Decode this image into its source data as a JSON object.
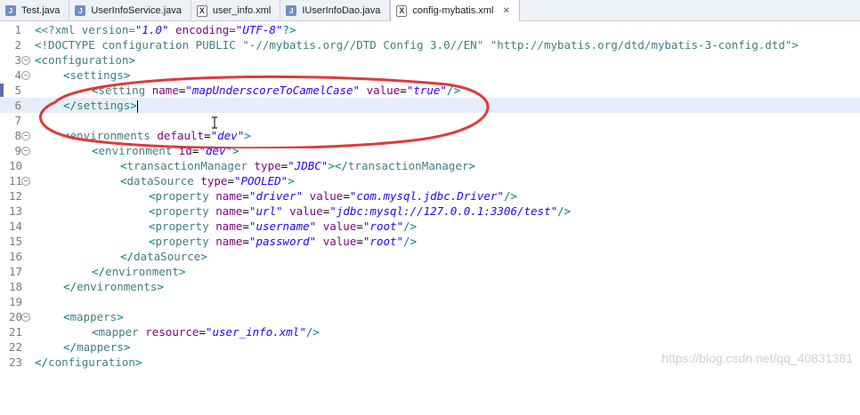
{
  "tabs": [
    {
      "label": "Test.java",
      "icon": "java-file-icon",
      "active": false
    },
    {
      "label": "UserInfoService.java",
      "icon": "java-file-icon",
      "active": false
    },
    {
      "label": "user_info.xml",
      "icon": "xml-file-icon",
      "active": false
    },
    {
      "label": "IUserInfoDao.java",
      "icon": "java-file-icon",
      "active": false
    },
    {
      "label": "config-mybatis.xml",
      "icon": "xml-file-icon",
      "active": true,
      "close": "✕"
    }
  ],
  "lines": [
    {
      "n": "1",
      "t1": "<?xml version=",
      "v1": "\"1.0\"",
      "t2": " encoding=",
      "v2": "\"UTF-8\"",
      "t3": "?>"
    },
    {
      "n": "2",
      "text": "<!DOCTYPE configuration PUBLIC \"-//mybatis.org//DTD Config 3.0//EN\" \"http://mybatis.org/dtd/mybatis-3-config.dtd\">"
    },
    {
      "n": "3",
      "tag": "configuration"
    },
    {
      "n": "4",
      "tag": "settings"
    },
    {
      "n": "5",
      "tag": "setting",
      "a1": "name",
      "v1": "\"mapUnderscoreToCamelCase\"",
      "a2": "value",
      "v2": "\"true\""
    },
    {
      "n": "6",
      "tag": "settings"
    },
    {
      "n": "7"
    },
    {
      "n": "8",
      "tag": "environments",
      "a1": "default",
      "v1": "\"dev\""
    },
    {
      "n": "9",
      "tag": "environment",
      "a1": "id",
      "v1": "\"dev\""
    },
    {
      "n": "10",
      "tag": "transactionManager",
      "a1": "type",
      "v1": "\"JDBC\"",
      "close": "transactionManager"
    },
    {
      "n": "11",
      "tag": "dataSource",
      "a1": "type",
      "v1": "\"POOLED\""
    },
    {
      "n": "12",
      "tag": "property",
      "a1": "name",
      "v1": "\"driver\"",
      "a2": "value",
      "v2": "\"com.mysql.jdbc.Driver\""
    },
    {
      "n": "13",
      "tag": "property",
      "a1": "name",
      "v1": "\"url\"",
      "a2": "value",
      "v2": "\"jdbc:mysql://127.0.0.1:3306/test\""
    },
    {
      "n": "14",
      "tag": "property",
      "a1": "name",
      "v1": "\"username\"",
      "a2": "value",
      "v2": "\"root\""
    },
    {
      "n": "15",
      "tag": "property",
      "a1": "name",
      "v1": "\"password\"",
      "a2": "value",
      "v2": "\"root\""
    },
    {
      "n": "16",
      "tag": "dataSource"
    },
    {
      "n": "17",
      "tag": "environment"
    },
    {
      "n": "18",
      "tag": "environments"
    },
    {
      "n": "19"
    },
    {
      "n": "20",
      "tag": "mappers"
    },
    {
      "n": "21",
      "tag": "mapper",
      "a1": "resource",
      "v1": "\"user_info.xml\""
    },
    {
      "n": "22",
      "tag": "mappers"
    },
    {
      "n": "23",
      "tag": "configuration"
    }
  ],
  "watermark": "https://blog.csdn.net/qq_40831381",
  "colors": {
    "tag": "#3f7f7f",
    "attr": "#7f007f",
    "value": "#2a00ff",
    "highlight_line": "#e6eefb",
    "annotation_circle": "#e03a3a"
  }
}
